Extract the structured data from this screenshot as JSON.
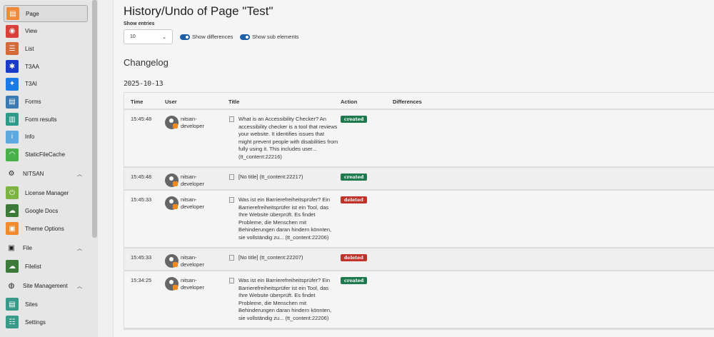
{
  "sidebar": {
    "items": [
      {
        "label": "Page",
        "color": "#f18a3a",
        "glyph": "▤"
      },
      {
        "label": "View",
        "color": "#d9403a",
        "glyph": "◉"
      },
      {
        "label": "List",
        "color": "#d46a3a",
        "glyph": "☰"
      },
      {
        "label": "T3AA",
        "color": "#1a3cc8",
        "glyph": "✱"
      },
      {
        "label": "T3AI",
        "color": "#1a7ae6",
        "glyph": "✦"
      },
      {
        "label": "Forms",
        "color": "#3a7ab0",
        "glyph": "▤"
      },
      {
        "label": "Form results",
        "color": "#2e9a8a",
        "glyph": "▥"
      },
      {
        "label": "Info",
        "color": "#5da8e0",
        "glyph": "i"
      },
      {
        "label": "StaticFileCache",
        "color": "#4ab04a",
        "glyph": "◠"
      }
    ],
    "groups": [
      {
        "label": "NITSAN",
        "glyph": "⚙",
        "items": [
          {
            "label": "License Manager",
            "color": "#7cb342",
            "glyph": "⏻"
          },
          {
            "label": "Google Docs",
            "color": "#3d7a3a",
            "glyph": "☁"
          },
          {
            "label": "Theme Options",
            "color": "#f18a2a",
            "glyph": "▣"
          }
        ]
      },
      {
        "label": "File",
        "glyph": "▣",
        "items": [
          {
            "label": "Filelist",
            "color": "#3d7a3a",
            "glyph": "☁"
          }
        ]
      },
      {
        "label": "Site Management",
        "glyph": "◍",
        "items": [
          {
            "label": "Sites",
            "color": "#3a9a8a",
            "glyph": "▤"
          },
          {
            "label": "Settings",
            "color": "#3a9a8a",
            "glyph": "☷"
          }
        ]
      }
    ]
  },
  "main": {
    "title": "History/Undo of Page \"Test\"",
    "show_entries_label": "Show entries",
    "show_entries_value": "10",
    "toggle_differences": "Show differences",
    "toggle_sub_elements": "Show sub elements",
    "changelog_heading": "Changelog",
    "date": "2025-10-13",
    "columns": [
      "Time",
      "User",
      "Title",
      "Action",
      "Differences"
    ],
    "rows": [
      {
        "time": "15:45:48",
        "user": "nitsan-developer",
        "title": "What is an Accessibility Checker? An accessibility checker is a tool that reviews your website. It identifies issues that might prevent people with disabilities from fully using it. This includes user... (tt_content:22216)",
        "action": "created"
      },
      {
        "time": "15:45:48",
        "user": "nitsan-developer",
        "title": "[No title] (tt_content:22217)",
        "action": "created"
      },
      {
        "time": "15:45:33",
        "user": "nitsan-developer",
        "title": "Was ist ein Barrierefreiheitsprüfer? Ein Barrierefreiheitsprüfer ist ein Tool, das Ihre Website überprüft. Es findet Probleme, die Menschen mit Behinderungen daran hindern könnten, sie vollständig zu... (tt_content:22206)",
        "action": "deleted"
      },
      {
        "time": "15:45:33",
        "user": "nitsan-developer",
        "title": "[No title] (tt_content:22207)",
        "action": "deleted"
      },
      {
        "time": "15:34:25",
        "user": "nitsan-developer",
        "title": "Was ist ein Barrierefreiheitsprüfer? Ein Barrierefreiheitsprüfer ist ein Tool, das Ihre Website überprüft. Es findet Probleme, die Menschen mit Behinderungen daran hindern könnten, sie vollständig zu... (tt_content:22206)",
        "action": "created"
      }
    ]
  },
  "colors": {
    "created": "#1e7a4e",
    "deleted": "#c0332b"
  }
}
